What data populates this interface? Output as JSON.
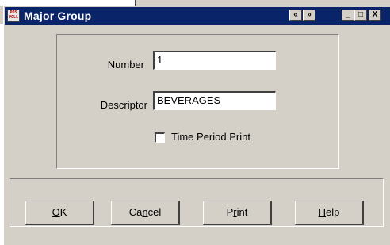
{
  "window": {
    "title": "Major Group",
    "app_icon_text": [
      "POS",
      "POLL"
    ]
  },
  "titlebar_buttons": {
    "prev": "«",
    "next": "»",
    "minimize": "_",
    "maximize": "□",
    "close": "X"
  },
  "form": {
    "number_label": "Number",
    "number_value": "1",
    "descriptor_label": "Descriptor",
    "descriptor_value": "BEVERAGES",
    "time_period_print_label": "Time Period Print",
    "time_period_print_checked": false
  },
  "buttons": {
    "ok": {
      "mnemonic": "O",
      "rest": "K"
    },
    "cancel": {
      "pre": "Ca",
      "mnemonic": "n",
      "rest": "cel"
    },
    "print": {
      "pre": "P",
      "mnemonic": "r",
      "rest": "int"
    },
    "help": {
      "mnemonic": "H",
      "rest": "elp"
    }
  },
  "colors": {
    "titlebar": "#0a246a",
    "face": "#d4d0c8"
  }
}
